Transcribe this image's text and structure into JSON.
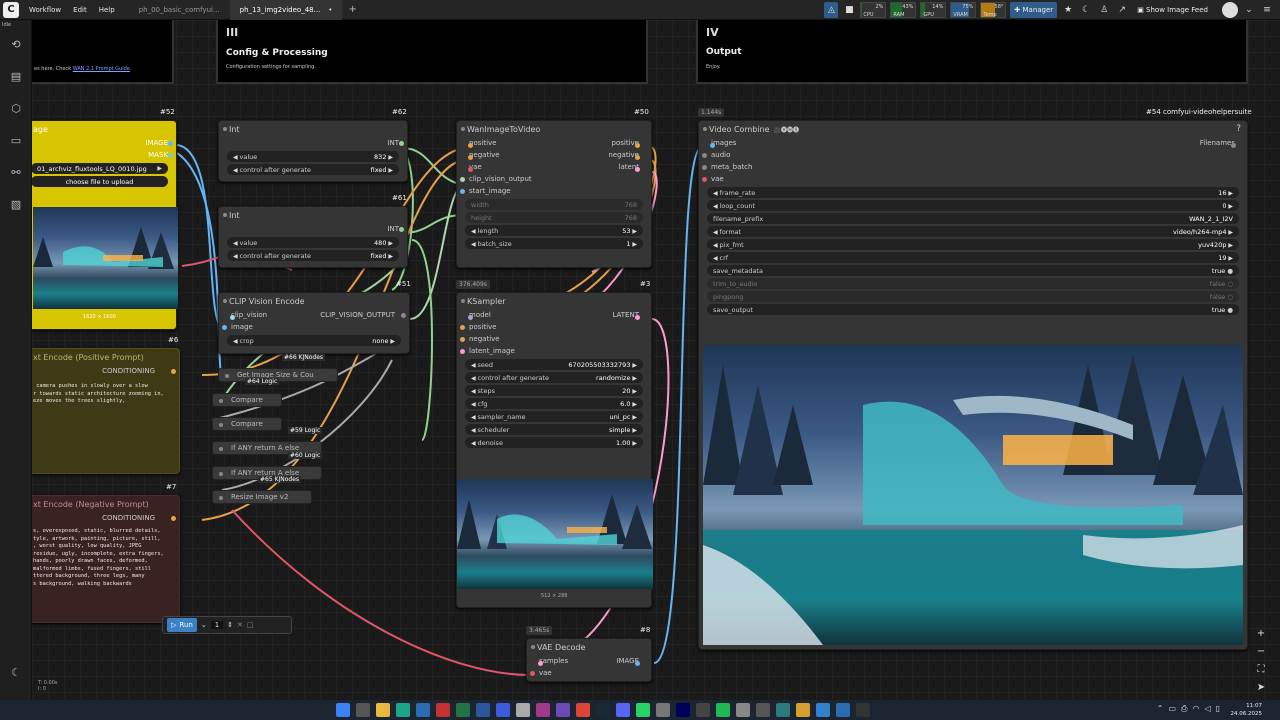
{
  "topbar": {
    "logo": "C",
    "menu": [
      "Workflow",
      "Edit",
      "Help"
    ],
    "tabs": [
      {
        "label": "ph_00_basic_comfyui...",
        "active": false
      },
      {
        "label": "ph_13_img2video_48...",
        "active": true,
        "dot": "•"
      }
    ],
    "plus": "+",
    "monitors": [
      {
        "label": "CPU",
        "value": "2%",
        "fill": 0.02
      },
      {
        "label": "RAM",
        "value": "43%",
        "fill": 0.43
      },
      {
        "label": "GPU",
        "value": "14%",
        "fill": 0.14
      },
      {
        "label": "VRAM",
        "value": "75%",
        "fill": 0.75
      },
      {
        "label": "Temp",
        "value": "58°",
        "fill": 0.58
      }
    ],
    "manager_label": "Manager",
    "image_feed_label": "Show Image Feed",
    "monitor_colors": {
      "cpu": "#1e6b2d",
      "vram": "#2f5c8a",
      "temp": "#b07d12"
    }
  },
  "groups": {
    "g3": {
      "num": "III",
      "title": "Config & Processing",
      "sub": "Configuration settings for sampling."
    },
    "g4": {
      "num": "IV",
      "title": "Output",
      "sub": "Enjoy."
    },
    "g2": {
      "sub_prefix": "es here. Check ",
      "link": "WAN 2.1 Prompt Guide"
    }
  },
  "nodes": {
    "load_image": {
      "id": "#52",
      "title": "age",
      "out1": "IMAGE",
      "out2": "MASK",
      "file": "01_archviz_fluxtools_LQ_0010.jpg",
      "upload": "choose file to upload",
      "dims": "1620 × 1600"
    },
    "int1": {
      "id": "#62",
      "title": "Int",
      "out": "INT",
      "w1": "value",
      "v1": "832",
      "w2": "control after generate",
      "v2": "fixed"
    },
    "int2": {
      "id": "#61",
      "title": "Int",
      "out": "INT",
      "w1": "value",
      "v1": "480",
      "w2": "control after generate",
      "v2": "fixed"
    },
    "clipvision": {
      "id": "#51",
      "title": "CLIP Vision Encode",
      "in1": "clip_vision",
      "in2": "image",
      "out": "CLIP_VISION_OUTPUT",
      "w1": "crop",
      "v1": "none"
    },
    "wan": {
      "id": "#50",
      "title": "WanImageToVideo",
      "in": [
        "positive",
        "negative",
        "vae",
        "clip_vision_output",
        "start_image"
      ],
      "out": [
        "positive",
        "negative",
        "latent"
      ],
      "w": [
        {
          "n": "width",
          "v": "768"
        },
        {
          "n": "height",
          "v": "768"
        },
        {
          "n": "length",
          "v": "53"
        },
        {
          "n": "batch_size",
          "v": "1"
        }
      ]
    },
    "ksampler": {
      "id": "#3",
      "timing": "376.409s",
      "title": "KSampler",
      "in": [
        "model",
        "positive",
        "negative",
        "latent_image"
      ],
      "out": "LATENT",
      "w": [
        {
          "n": "seed",
          "v": "670205503332793"
        },
        {
          "n": "control after generate",
          "v": "randomize"
        },
        {
          "n": "steps",
          "v": "20"
        },
        {
          "n": "cfg",
          "v": "6.0"
        },
        {
          "n": "sampler_name",
          "v": "uni_pc"
        },
        {
          "n": "scheduler",
          "v": "simple"
        },
        {
          "n": "denoise",
          "v": "1.00"
        }
      ],
      "preview_dims": "512 × 288"
    },
    "videocombine": {
      "id": "#54 comfyui-videohelpersuite",
      "timing": "1.144s",
      "title": "Video Combine",
      "title_icons": "🎥🅥🅗🅢",
      "help": "?",
      "in": [
        "images",
        "audio",
        "meta_batch",
        "vae"
      ],
      "out": "Filenames",
      "w": [
        {
          "n": "frame_rate",
          "v": "16"
        },
        {
          "n": "loop_count",
          "v": "0"
        },
        {
          "n": "filename_prefix",
          "v": "WAN_2_1_I2V"
        },
        {
          "n": "format",
          "v": "video/h264-mp4"
        },
        {
          "n": "pix_fmt",
          "v": "yuv420p"
        },
        {
          "n": "crf",
          "v": "19"
        },
        {
          "n": "save_metadata",
          "v": "true"
        },
        {
          "n": "trim_to_audio",
          "v": "false"
        },
        {
          "n": "pingpong",
          "v": "false"
        },
        {
          "n": "save_output",
          "v": "true"
        }
      ]
    },
    "vaedecode": {
      "id": "#8",
      "timing": "3.465s",
      "title": "VAE Decode",
      "in1": "samples",
      "in2": "vae",
      "out": "IMAGE"
    },
    "pos_prompt": {
      "id": "#6",
      "title": "xt Encode (Positive Prompt)",
      "out": "CONDITIONING",
      "text": " camera pushes in slowly over a slow\nr towards static architecture zooming in,\neze moves the trees slightly,"
    },
    "neg_prompt": {
      "id": "#7",
      "title": "xt Encode (Negative Prompt)",
      "out": "CONDITIONING",
      "text": "s, overexposed, static, blurred details,\ntyle, artwork, painting, picture, still,\n, worst quality, low quality, JPEG\nresidue, ugly, incomplete, extra fingers,\nhands, poorly drawn faces, deformed,\nmalformed limbs, fused fingers, still\nttered background, three legs, many\ns background, walking backwards"
    },
    "small": {
      "getimg": "Get Image Size & Cou",
      "kj1": "#66 KJNodes",
      "logic64": "#64 Logic",
      "compare1": "Compare",
      "compare2": "Compare",
      "logic59": "#59 Logic",
      "ifany1": "If ANY return A else",
      "logic60": "#60 Logic",
      "ifany2": "If ANY return A else",
      "kj65": "#65 KJNodes",
      "resize": "Resize Image v2"
    }
  },
  "runbar": {
    "run": "Run",
    "count": "1"
  },
  "footer": {
    "fps": "T: 0.00s",
    "nodes": "I: 0"
  },
  "taskbar": {
    "time": "11:07",
    "date": "24.06.2025"
  }
}
